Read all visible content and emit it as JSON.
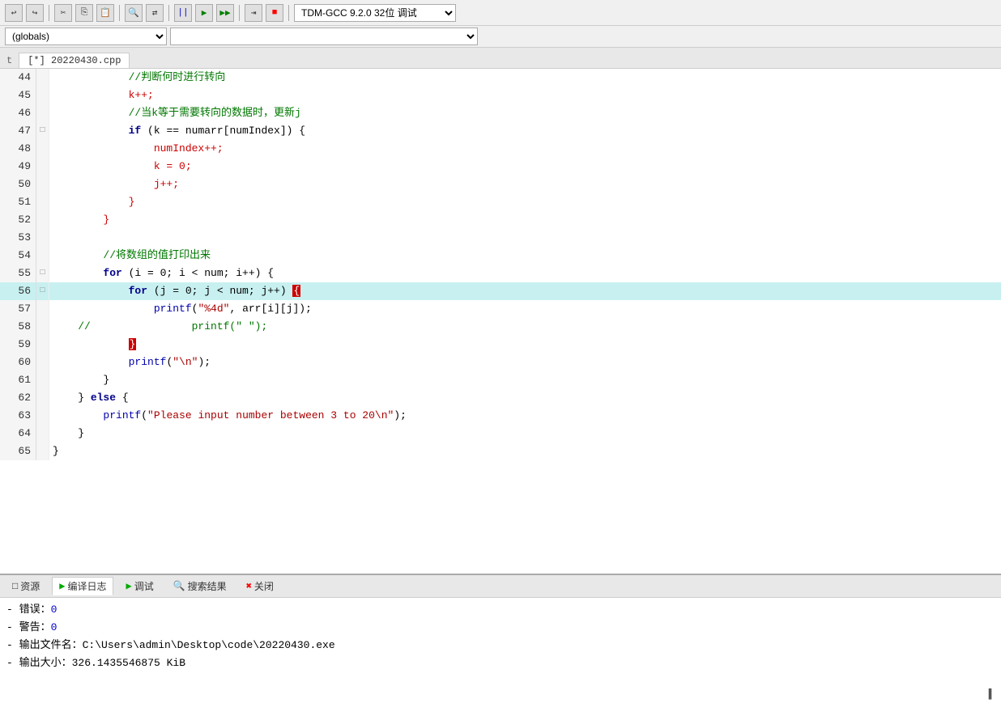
{
  "toolbar": {
    "buttons": [
      "undo",
      "redo",
      "cut",
      "copy",
      "paste",
      "find",
      "replace",
      "compile",
      "run",
      "run-args",
      "step-into",
      "stop",
      "dropdown-compiler"
    ],
    "compiler_label": "TDM-GCC 9.2.0 32位  调试"
  },
  "dropdown_bar": {
    "left": "(globals)",
    "right": ""
  },
  "tab": {
    "label": "[*] 20220430.cpp"
  },
  "code": {
    "lines": [
      {
        "num": 44,
        "fold": "",
        "content": "            //判断何时进行转向",
        "type": "comment"
      },
      {
        "num": 45,
        "fold": "",
        "content": "            k++;",
        "type": "plain"
      },
      {
        "num": 46,
        "fold": "",
        "content": "            //当k等于需要转向的数据时，更新j",
        "type": "comment"
      },
      {
        "num": 47,
        "fold": "□",
        "content": "            if (k == numarr[numIndex]) {",
        "type": "if"
      },
      {
        "num": 48,
        "fold": "",
        "content": "                numIndex++;",
        "type": "plain"
      },
      {
        "num": 49,
        "fold": "",
        "content": "                k = 0;",
        "type": "plain"
      },
      {
        "num": 50,
        "fold": "",
        "content": "                j++;",
        "type": "plain"
      },
      {
        "num": 51,
        "fold": "",
        "content": "            }",
        "type": "plain"
      },
      {
        "num": 52,
        "fold": "",
        "content": "        }",
        "type": "plain"
      },
      {
        "num": 53,
        "fold": "",
        "content": "",
        "type": "plain"
      },
      {
        "num": 54,
        "fold": "",
        "content": "        //将数组的值打印出来",
        "type": "comment"
      },
      {
        "num": 55,
        "fold": "□",
        "content": "        for (i = 0; i < num; i++) {",
        "type": "for"
      },
      {
        "num": 56,
        "fold": "□",
        "content": "            for (j = 0; j < num; j++) {",
        "type": "for_highlight"
      },
      {
        "num": 57,
        "fold": "",
        "content": "                printf(\"%4d\", arr[i][j]);",
        "type": "printf"
      },
      {
        "num": 58,
        "fold": "",
        "content": "//                printf(\" \");",
        "type": "comment_inline"
      },
      {
        "num": 59,
        "fold": "",
        "content": "            }",
        "type": "brace_red"
      },
      {
        "num": 60,
        "fold": "",
        "content": "            printf(\"\\n\");",
        "type": "printf2"
      },
      {
        "num": 61,
        "fold": "",
        "content": "        }",
        "type": "plain"
      },
      {
        "num": 62,
        "fold": "",
        "content": "    } else {",
        "type": "else"
      },
      {
        "num": 63,
        "fold": "",
        "content": "        printf(\"Please input number between 3 to 20\\n\");",
        "type": "printf3"
      },
      {
        "num": 64,
        "fold": "",
        "content": "    }",
        "type": "plain"
      },
      {
        "num": 65,
        "fold": "",
        "content": "}",
        "type": "plain"
      }
    ]
  },
  "bottom_tabs": [
    {
      "id": "resources",
      "label": "资源",
      "icon": ""
    },
    {
      "id": "compile-log",
      "label": "编译日志",
      "icon": "▶"
    },
    {
      "id": "debug",
      "label": "调试",
      "icon": "▶"
    },
    {
      "id": "search",
      "label": "搜索结果",
      "icon": "🔍"
    },
    {
      "id": "close",
      "label": "关闭",
      "icon": "✖"
    }
  ],
  "bottom_content": {
    "lines": [
      {
        "label": "- 错误：",
        "value": "0"
      },
      {
        "label": "- 警告：",
        "value": "0"
      },
      {
        "label": "- 输出文件名：",
        "value": "C:\\Users\\admin\\Desktop\\code\\20220430.exe"
      },
      {
        "label": "- 输出大小：",
        "value": "326.1435546875 KiB"
      }
    ]
  },
  "cursor": "▌"
}
